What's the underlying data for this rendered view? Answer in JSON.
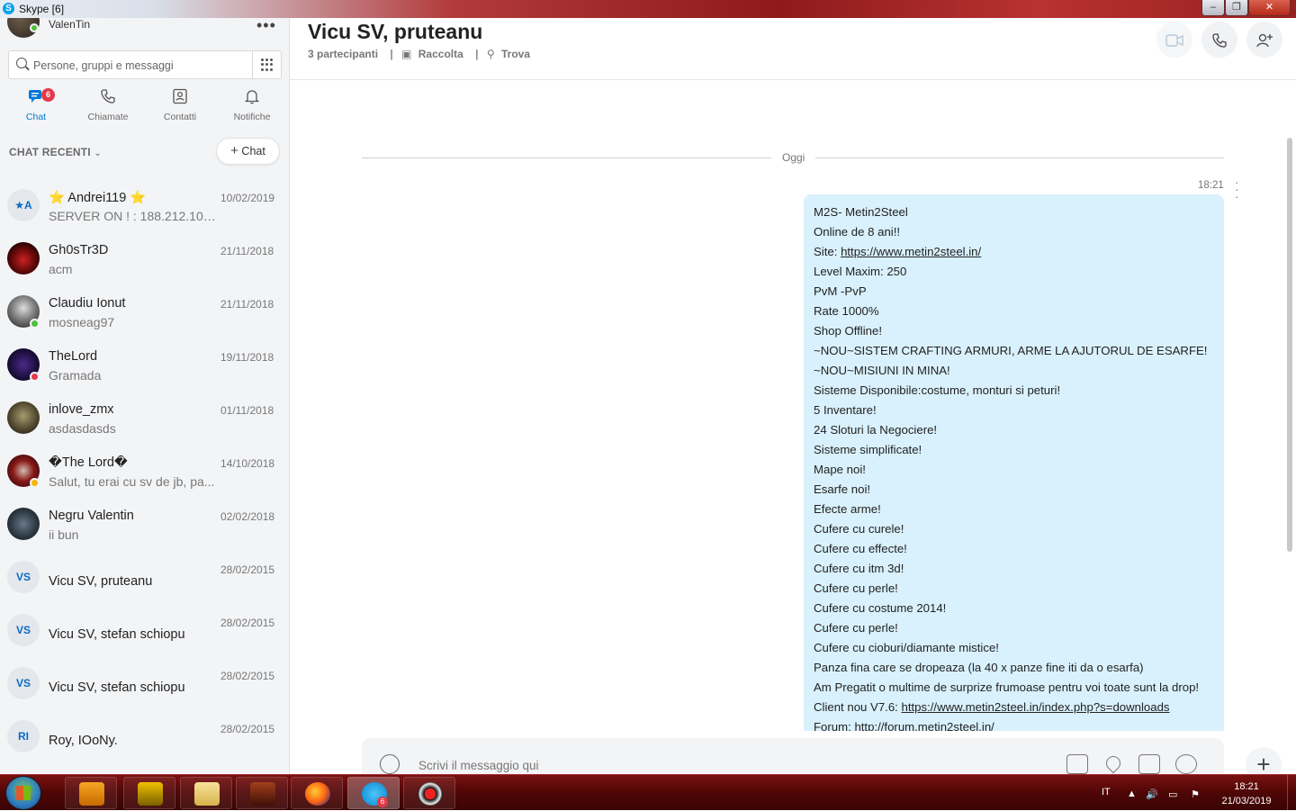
{
  "window": {
    "title": "Skype [6]",
    "min_label": "‒",
    "max_label": "❐",
    "close_label": "✕"
  },
  "profile": {
    "name": "ValenTin",
    "status_color": "#4fbf40"
  },
  "search": {
    "placeholder": "Persone, gruppi e messaggi"
  },
  "nav": {
    "chat": "Chat",
    "chat_badge": "6",
    "calls": "Chiamate",
    "contacts": "Contatti",
    "notifications": "Notifiche"
  },
  "recent": {
    "header": "CHAT RECENTI",
    "new_chat": "Chat"
  },
  "chats": [
    {
      "name": "⭐ Andrei119 ⭐",
      "preview": "SERVER ON ! : 188.212.100....",
      "date": "10/02/2019",
      "initials": "★A"
    },
    {
      "name": "Gh0sTr3D",
      "preview": "acm",
      "date": "21/11/2018"
    },
    {
      "name": "Claudiu Ionut",
      "preview": "mosneag97",
      "date": "21/11/2018",
      "status_color": "#4fbf40"
    },
    {
      "name": "TheLord",
      "preview": "Gramada",
      "date": "19/11/2018",
      "status_color": "#e3394a"
    },
    {
      "name": "inlove_zmx",
      "preview": "asdasdasds",
      "date": "01/11/2018"
    },
    {
      "name": "�The Lord�",
      "preview": "Salut, tu erai cu sv de jb, pa...",
      "date": "14/10/2018",
      "status_color": "#f5b400"
    },
    {
      "name": "Negru Valentin",
      "preview": "ii bun",
      "date": "02/02/2018"
    },
    {
      "name": "Vicu SV, pruteanu",
      "preview": "",
      "date": "28/02/2015",
      "initials": "VS"
    },
    {
      "name": "Vicu SV, stefan schiopu",
      "preview": "",
      "date": "28/02/2015",
      "initials": "VS"
    },
    {
      "name": "Vicu SV, stefan schiopu",
      "preview": "",
      "date": "28/02/2015",
      "initials": "VS"
    },
    {
      "name": "Roy, IOoNy.",
      "preview": "",
      "date": "28/02/2015",
      "initials": "RI"
    }
  ],
  "conversation": {
    "title": "Vicu SV, pruteanu",
    "participants": "3 partecipanti",
    "gallery": "Raccolta",
    "find": "Trova",
    "date_separator": "Oggi",
    "message_time": "18:21",
    "message_lines": [
      "M2S- Metin2Steel",
      "Online de 8 ani!!",
      "Site: https://www.metin2steel.in/",
      "Level Maxim: 250",
      "PvM -PvP",
      "Rate 1000%",
      "Shop Offline!",
      "~NOU~SISTEM CRAFTING ARMURI, ARME LA AJUTORUL DE ESARFE!",
      "~NOU~MISIUNI IN MINA!",
      "Sisteme Disponibile:costume, monturi si peturi!",
      "5 Inventare!",
      "24 Sloturi la Negociere!",
      "Sisteme simplificate!",
      "Mape noi!",
      "Esarfe noi!",
      "Efecte arme!",
      "Cufere cu curele!",
      "Cufere cu effecte!",
      "Cufere cu itm 3d!",
      "Cufere cu perle!",
      "Cufere cu costume 2014!",
      "Cufere cu perle!",
      "Cufere cu cioburi/diamante mistice!",
      "Panza fina care se dropeaza (la 40 x panze fine iti da o esarfa)",
      "Am Pregatit o multime de surprize frumoase pentru voi toate sunt la drop!",
      "Client nou V7.6: https://www.metin2steel.in/index.php?s=downloads",
      "Forum: http://forum.metin2steel.in/"
    ],
    "composer_placeholder": "Scrivi il messaggio qui"
  },
  "taskbar": {
    "language": "IT",
    "time": "18:21",
    "date": "21/03/2019",
    "skype_badge": "6"
  }
}
